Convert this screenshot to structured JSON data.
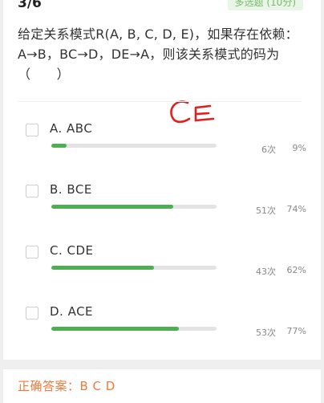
{
  "question": {
    "index": "3/6",
    "type_badge": "多选题 (10分)",
    "text": "给定关系模式R(A, B, C, D, E)，如果存在依赖：A→B，BC→D，DE→A，则该关系模式的码为（　　）"
  },
  "handwriting": "CE",
  "options": [
    {
      "label": "A. ABC",
      "count": "6次",
      "percent": "9%",
      "fraction": 0.09
    },
    {
      "label": "B. BCE",
      "count": "51次",
      "percent": "74%",
      "fraction": 0.74
    },
    {
      "label": "C. CDE",
      "count": "43次",
      "percent": "62%",
      "fraction": 0.62
    },
    {
      "label": "D. ACE",
      "count": "53次",
      "percent": "77%",
      "fraction": 0.77
    }
  ],
  "answer": "正确答案：B C D",
  "colors": {
    "bar": "#4caf50",
    "answer": "#f07a3b",
    "handwriting": "#e02020"
  }
}
